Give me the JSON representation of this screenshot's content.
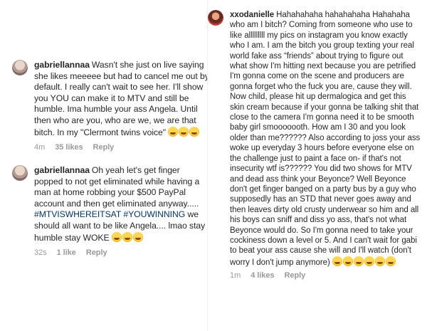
{
  "left_comments": [
    {
      "username": "gabriellannaa",
      "text": "Wasn't she just on live saying she likes meeeee but had to cancel me out by default. I really can't wait to see her. I'll show you YOU can make it to MTV and still be humble. Ima humble your ass Angela. Until then who are you, who are we, we are that bitch. In my \"Clermont twins voice\"",
      "emojis": [
        "tears-of-joy-emoji",
        "tears-of-joy-emoji",
        "tears-of-joy-emoji"
      ],
      "time": "4m",
      "likes": "35 likes",
      "reply": "Reply"
    },
    {
      "username": "gabriellannaa",
      "text_before": "Oh yeah let's get finger popped to not get eliminated while having a man at home robbing your $500 PayPal account and then get eliminated anyway..... ",
      "hashtag1": "#MTVISWHEREITSAT",
      "hashtag2": "#YOUWINNING",
      "text_after": " we should all want to be like Angela.... lmao stay humble stay WOKE",
      "emojis": [
        "tears-of-joy-emoji",
        "tears-of-joy-emoji",
        "tears-of-joy-emoji"
      ],
      "time": "32s",
      "likes": "1 like",
      "reply": "Reply"
    }
  ],
  "right_comment": {
    "username": "xxodanielle",
    "text": "Hahahahaha hahahahaha Hahahaha who am I bitch? Coming from someone who use to like alllllllll my pics on instagram you know exactly who I am. I am the bitch you group texting your real world fake ass “friends” about trying to figure out what show I'm hitting next because you are petrified I'm gonna come on the scene and producers are gonna forget who the fuck you are, cause they will. Now child, please hit up dermalogica and get this skin cream because if your gonna be talking shit that close to the camera I'm gonna need it to be smooth baby girl smooooooth. How am I 30 and you look older than me?????? Also according to joss your ass woke up everyday 3 hours before everyone else on the challenge just to paint a face on- if that's not insecurity wtf is?????? You did two shows for MTV and dead ass think your Beyonce? Well Beyonce don't get finger banged on a party bus by a guy who supposedly has an STD that never goes away and then leaves dirty old crusty underwear so him and all his boys can sniff and diss yo ass, that's not what Beyonce would do. So I'm gonna need to take your cockiness down a level or 5. And I can't wait for gabi to beat your ass cause she will and I'll watch (don't worry I don't jump anymore)",
    "emojis": [
      "smiling-emoji",
      "smiling-emoji",
      "smiling-emoji",
      "smiling-emoji",
      "smiling-emoji",
      "smiling-emoji"
    ],
    "time": "1m",
    "likes": "4 likes",
    "reply": "Reply"
  }
}
